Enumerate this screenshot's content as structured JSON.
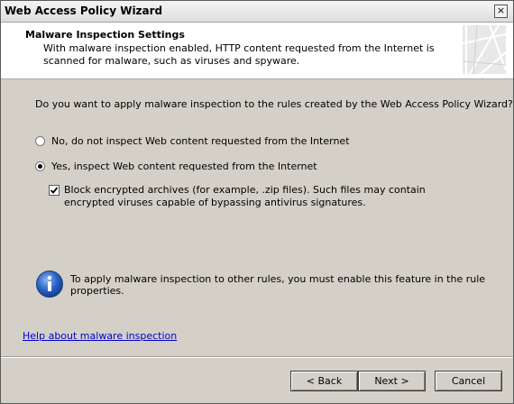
{
  "window": {
    "title": "Web Access Policy Wizard",
    "close_glyph": "×"
  },
  "header": {
    "title": "Malware Inspection Settings",
    "description": "With malware inspection enabled, HTTP content requested from the Internet is scanned for malware, such as viruses and spyware.",
    "graphic_icon": "wizard-banner-graphic"
  },
  "question": "Do you want to apply malware inspection to the rules created by the Web Access Policy Wizard?",
  "options": {
    "no_label": "No, do not inspect Web content requested from the Internet",
    "yes_label": "Yes, inspect Web content requested from the Internet",
    "selected": "yes"
  },
  "block_archives": {
    "label": "Block encrypted archives (for example, .zip files). Such files may contain encrypted viruses capable of bypassing antivirus signatures.",
    "checked": true
  },
  "info": {
    "icon": "info-icon",
    "text": "To apply malware inspection to other rules, you must enable this feature in the rule properties."
  },
  "help_link": "Help about malware inspection",
  "buttons": {
    "back": "< Back",
    "next": "Next >",
    "cancel": "Cancel"
  }
}
